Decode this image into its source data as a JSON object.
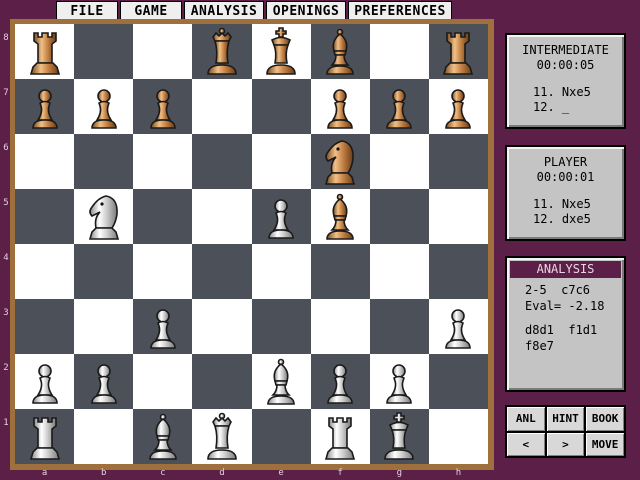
{
  "menu": {
    "file": "FILE",
    "game": "GAME",
    "analysis": "ANALYSIS",
    "openings": "OPENINGS",
    "preferences": "PREFERENCES"
  },
  "board": {
    "ranks": [
      "8",
      "7",
      "6",
      "5",
      "4",
      "3",
      "2",
      "1"
    ],
    "files": [
      "a",
      "b",
      "c",
      "d",
      "e",
      "f",
      "g",
      "h"
    ],
    "position": [
      [
        "bR",
        "",
        "",
        "bQ",
        "bK",
        "bB",
        "",
        "bR"
      ],
      [
        "bP",
        "bP",
        "bP",
        "",
        "",
        "bP",
        "bP",
        "bP"
      ],
      [
        "",
        "",
        "",
        "",
        "",
        "bN",
        "",
        ""
      ],
      [
        "",
        "wN",
        "",
        "",
        "wP",
        "bB",
        "",
        ""
      ],
      [
        "",
        "",
        "",
        "",
        "",
        "",
        "",
        ""
      ],
      [
        "",
        "",
        "wP",
        "",
        "",
        "",
        "",
        "wP"
      ],
      [
        "wP",
        "wP",
        "",
        "",
        "wB",
        "wP",
        "wP",
        ""
      ],
      [
        "wR",
        "",
        "wB",
        "wQ",
        "",
        "wR",
        "wK",
        ""
      ]
    ],
    "colors": {
      "light": "#ffffff",
      "dark": "#4c5058",
      "black_pieces": "bronze",
      "white_pieces": "silver"
    }
  },
  "ai_panel": {
    "title": "INTERMEDIATE",
    "clock": "00:00:05",
    "move1": "11. Nxe5",
    "move2": "12. _"
  },
  "player_panel": {
    "title": "PLAYER",
    "clock": "00:00:01",
    "move1": "11. Nxe5",
    "move2": "12. dxe5"
  },
  "analysis_panel": {
    "title": "ANALYSIS",
    "depth_line": "2-5  c7c6",
    "eval_line": "Eval= -2.18",
    "pv_line1": "d8d1  f1d1",
    "pv_line2": "f8e7"
  },
  "buttons": {
    "anl": "ANL",
    "hint": "HINT",
    "book": "BOOK",
    "back": "<",
    "forward": ">",
    "move": "MOVE"
  }
}
